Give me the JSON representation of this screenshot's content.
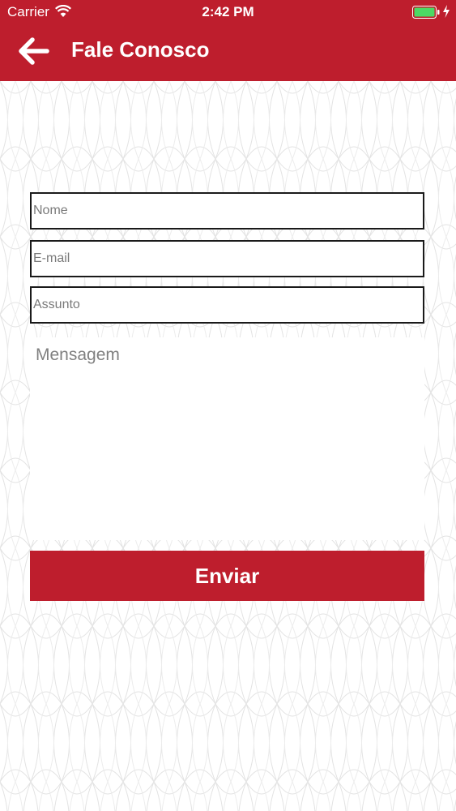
{
  "status_bar": {
    "carrier": "Carrier",
    "time": "2:42 PM"
  },
  "nav": {
    "title": "Fale Conosco",
    "back_icon": "arrow-left-icon"
  },
  "form": {
    "name_placeholder": "Nome",
    "email_placeholder": "E-mail",
    "subject_placeholder": "Assunto",
    "message_placeholder": "Mensagem",
    "submit_label": "Enviar"
  },
  "colors": {
    "brand": "#be1e2d",
    "border": "#1a1a1a",
    "placeholder": "#7a7a7a"
  }
}
